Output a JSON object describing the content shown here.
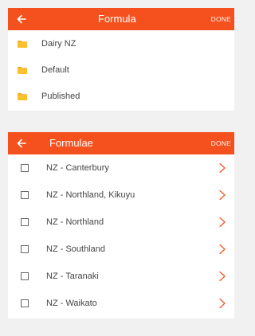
{
  "formula_panel": {
    "back_icon": "arrow-left-icon",
    "title": "Formula",
    "done_label": "DONE",
    "accent_color": "#f4511e",
    "folder_color": "#f9a825",
    "folders": [
      {
        "label": "Dairy NZ",
        "icon": "folder-icon"
      },
      {
        "label": "Default",
        "icon": "folder-icon"
      },
      {
        "label": "Published",
        "icon": "folder-icon"
      }
    ]
  },
  "formulae_panel": {
    "back_icon": "arrow-left-icon",
    "title": "Formulae",
    "done_label": "DONE",
    "chevron_color": "#f4511e",
    "items": [
      {
        "label": "NZ - Canterbury",
        "checked": false
      },
      {
        "label": "NZ - Northland, Kikuyu",
        "checked": false
      },
      {
        "label": "NZ - Northland",
        "checked": false
      },
      {
        "label": "NZ - Southland",
        "checked": false
      },
      {
        "label": "NZ - Taranaki",
        "checked": false
      },
      {
        "label": "NZ - Waikato",
        "checked": false
      }
    ]
  }
}
